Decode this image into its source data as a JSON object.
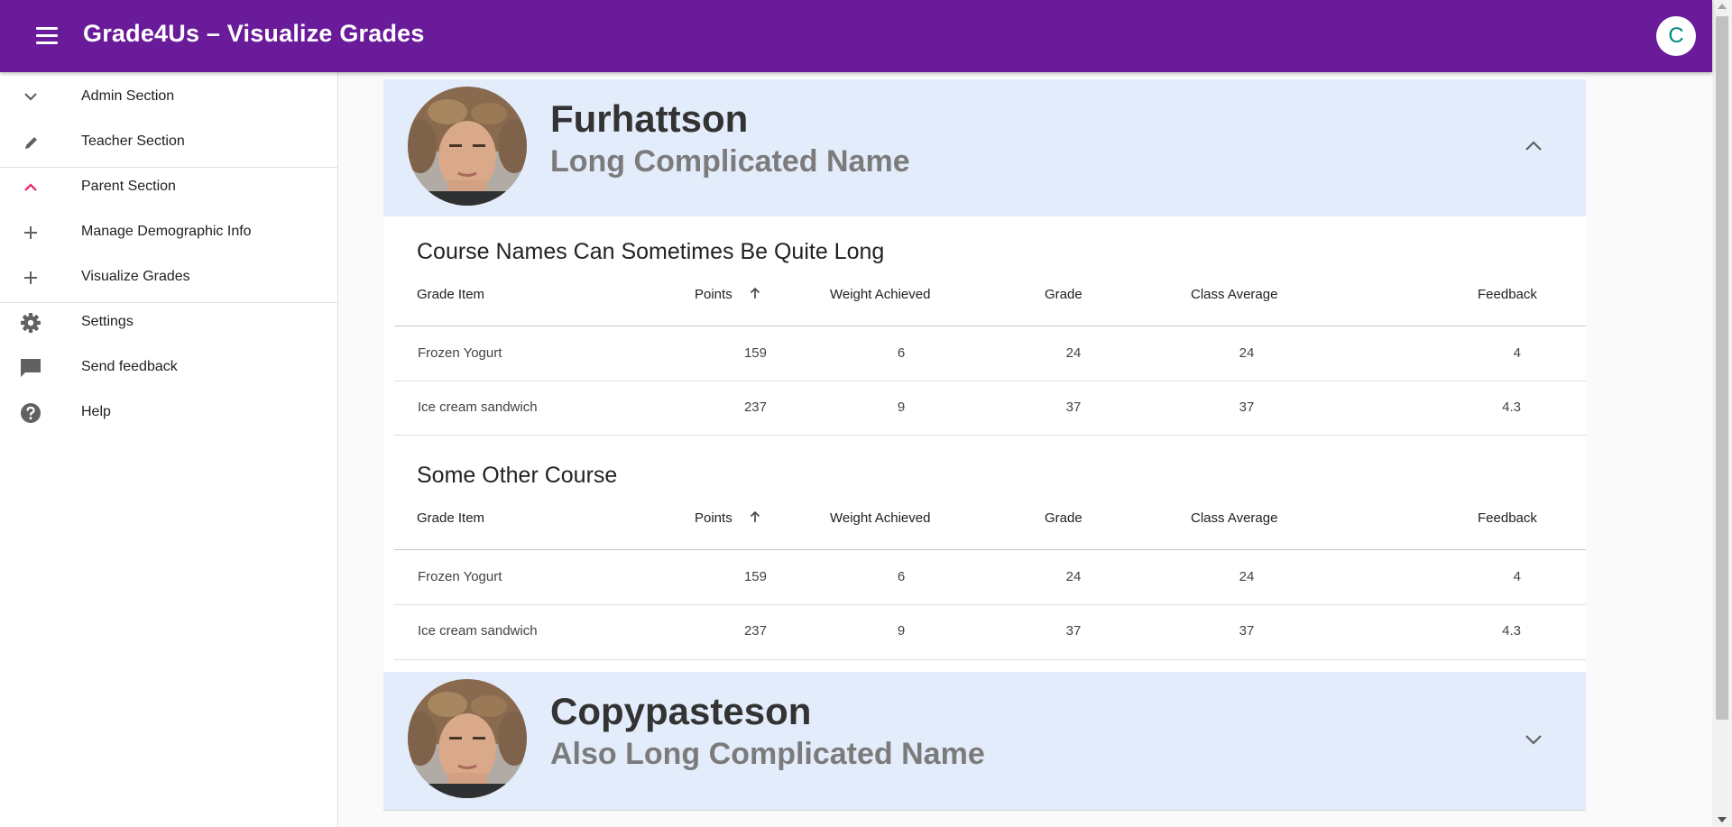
{
  "app": {
    "title": "Grade4Us – Visualize Grades",
    "account_initial": "C"
  },
  "sidebar": {
    "items": [
      {
        "label": "Admin Section",
        "icon": "chevron-down-icon"
      },
      {
        "label": "Teacher Section",
        "icon": "pencil-icon"
      },
      {
        "label": "Parent Section",
        "icon": "chevron-up-icon"
      },
      {
        "label": "Manage Demographic Info",
        "icon": "plus-icon"
      },
      {
        "label": "Visualize Grades",
        "icon": "plus-icon"
      },
      {
        "label": "Settings",
        "icon": "gear-icon"
      },
      {
        "label": "Send feedback",
        "icon": "feedback-icon"
      },
      {
        "label": "Help",
        "icon": "help-icon"
      }
    ]
  },
  "columns": [
    "Grade Item",
    "Points",
    "Weight Achieved",
    "Grade",
    "Class Average",
    "Feedback"
  ],
  "students": [
    {
      "name": "Furhattson",
      "subtitle": "Long Complicated Name",
      "expanded": true,
      "courses": [
        {
          "title": "Course Names Can Sometimes Be Quite Long",
          "rows": [
            [
              "Frozen Yogurt",
              "159",
              "6",
              "24",
              "24",
              "4"
            ],
            [
              "Ice cream sandwich",
              "237",
              "9",
              "37",
              "37",
              "4.3"
            ]
          ]
        },
        {
          "title": "Some Other Course",
          "rows": [
            [
              "Frozen Yogurt",
              "159",
              "6",
              "24",
              "24",
              "4"
            ],
            [
              "Ice cream sandwich",
              "237",
              "9",
              "37",
              "37",
              "4.3"
            ]
          ]
        }
      ]
    },
    {
      "name": "Copypasteson",
      "subtitle": "Also Long Complicated Name",
      "expanded": false,
      "courses": []
    }
  ],
  "colors": {
    "app_bar": "#6a1b9a",
    "panel_header": "#e3ecfa",
    "active_icon": "#e91e63",
    "avatar_text": "#00897b"
  }
}
